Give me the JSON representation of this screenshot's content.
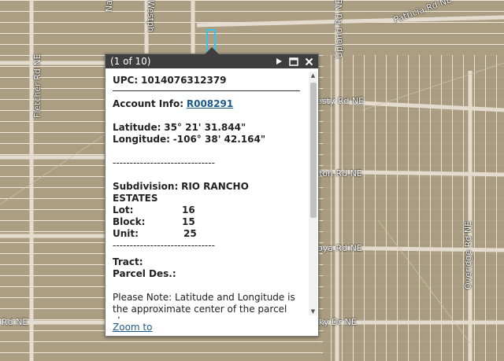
{
  "map": {
    "road_labels": [
      {
        "id": "na",
        "text": "Na"
      },
      {
        "id": "westph",
        "text": "Westph"
      },
      {
        "id": "upland",
        "text": "Upland Rd NE"
      },
      {
        "id": "patricia",
        "text": "Patricia Rd NE"
      },
      {
        "id": "fletcher",
        "text": "Fletcher Rd NE"
      },
      {
        "id": "esty",
        "text": "esty Rd NE"
      },
      {
        "id": "ton",
        "text": "ton Rd NE"
      },
      {
        "id": "oya",
        "text": "oya Rd NE"
      },
      {
        "id": "overidge",
        "text": "Overidge Rd NE"
      },
      {
        "id": "rdne",
        "text": "Rd NE"
      },
      {
        "id": "kydr",
        "text": "ky Dr NE"
      }
    ],
    "highlight_color": "#35c6f0"
  },
  "popup": {
    "counter": "(1 of 10)",
    "upc_label": "UPC:",
    "upc_value": "1014076312379",
    "account_label": "Account Info:",
    "account_value": "R008291",
    "latitude_label": "Latitude:",
    "latitude_value": "35° 21' 31.844\"",
    "longitude_label": "Longitude:",
    "longitude_value": "-106° 38' 42.164\"",
    "dashes": "------------------------------",
    "subdivision_label": "Subdivision:",
    "subdivision_value": "RIO RANCHO",
    "subdivision_value2": "ESTATES",
    "lot_label": "Lot:",
    "lot_value": "16",
    "block_label": "Block:",
    "block_value": "15",
    "unit_label": "Unit:",
    "unit_value": "25",
    "tract_label": "Tract:",
    "parcel_label": "Parcel Des.:",
    "note": "Please Note: Latitude and Longitude is the approximate center of the parcel shown",
    "zoom_label": "Zoom to",
    "icons": [
      "play-icon",
      "maximize-icon",
      "close-icon"
    ]
  }
}
